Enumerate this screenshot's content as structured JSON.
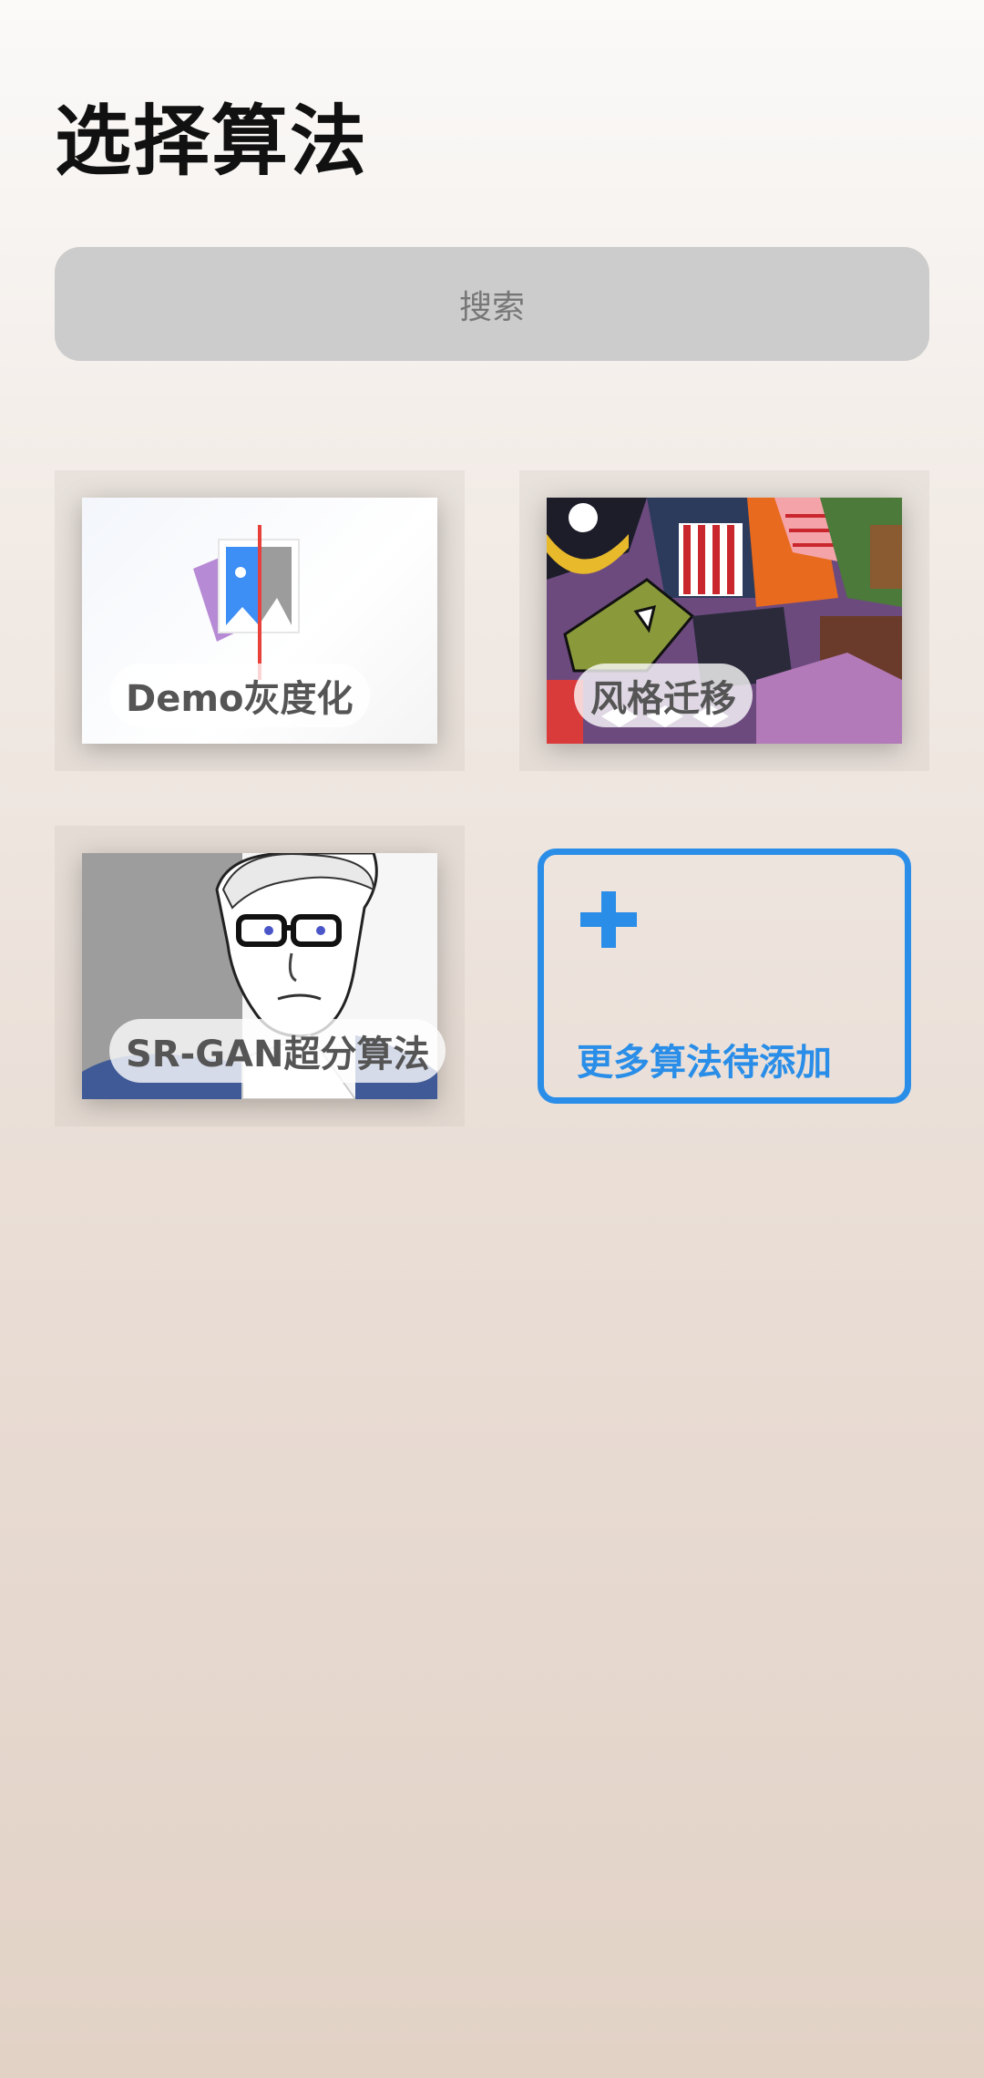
{
  "title": "选择算法",
  "search": {
    "placeholder": "搜索"
  },
  "algorithms": [
    {
      "label": "Demo灰度化"
    },
    {
      "label": "风格迁移"
    },
    {
      "label": "SR-GAN超分算法"
    }
  ],
  "add_more": {
    "label": "更多算法待添加"
  },
  "colors": {
    "accent": "#2a8ee8"
  },
  "icons": {
    "add": "plus-icon"
  }
}
